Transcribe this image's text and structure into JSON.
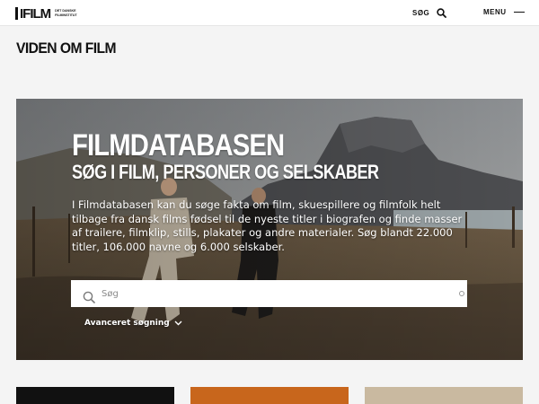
{
  "header": {
    "logo_text": "IFILM",
    "logo_subtitle": "DET DANSKE FILMINSTITUT",
    "search_label": "SØG",
    "menu_label": "MENU"
  },
  "section": {
    "title": "VIDEN OM FILM"
  },
  "hero": {
    "title": "FILMDATABASEN",
    "subtitle": "SØG I FILM, PERSONER OG SELSKABER",
    "description": "I Filmdatabasen kan du søge fakta om film, skuespillere og filmfolk helt tilbage fra dansk films fødsel til de nyeste titler i biografen og finde masser af trailere, filmklip, stills, plakater og andre materialer. Søg blandt 22.000 titler, 106.000 navne og 6.000 selskaber.",
    "search_placeholder": "Søg",
    "advanced_label": "Avanceret søgning"
  },
  "icons": {
    "search": "search-icon",
    "menu": "menu-icon",
    "chevron": "chevron-down-icon"
  },
  "colors": {
    "topbar_bg": "#ffffff",
    "page_bg": "#f4f4f4",
    "text": "#111111",
    "hero_text": "#ffffff"
  }
}
